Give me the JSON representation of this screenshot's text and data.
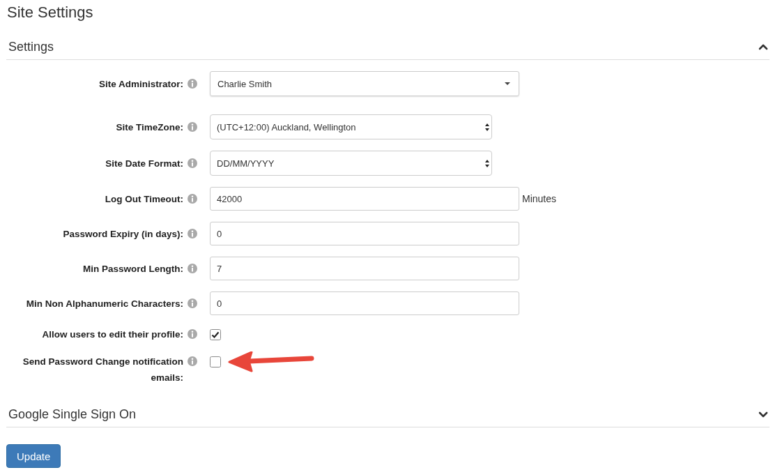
{
  "page_title": "Site Settings",
  "sections": [
    {
      "title": "Settings",
      "expanded": true,
      "fields": [
        {
          "kind": "dropdown",
          "label": "Site Administrator:",
          "value": "Charlie Smith"
        },
        {
          "kind": "select",
          "label": "Site TimeZone:",
          "value": "(UTC+12:00) Auckland, Wellington"
        },
        {
          "kind": "select",
          "label": "Site Date Format:",
          "value": "DD/MM/YYYY"
        },
        {
          "kind": "text",
          "label": "Log Out Timeout:",
          "value": "42000",
          "suffix": "Minutes"
        },
        {
          "kind": "text",
          "label": "Password Expiry (in days):",
          "value": "0"
        },
        {
          "kind": "text",
          "label": "Min Password Length:",
          "value": "7"
        },
        {
          "kind": "text",
          "label": "Min Non Alphanumeric Characters:",
          "value": "0"
        },
        {
          "kind": "checkbox",
          "label": "Allow users to edit their profile:",
          "checked": true
        },
        {
          "kind": "checkbox",
          "label": "Send Password Change notification emails:",
          "checked": false,
          "annotated": true
        }
      ]
    },
    {
      "title": "Google Single Sign On",
      "expanded": false
    }
  ],
  "buttons": [
    "Update"
  ]
}
